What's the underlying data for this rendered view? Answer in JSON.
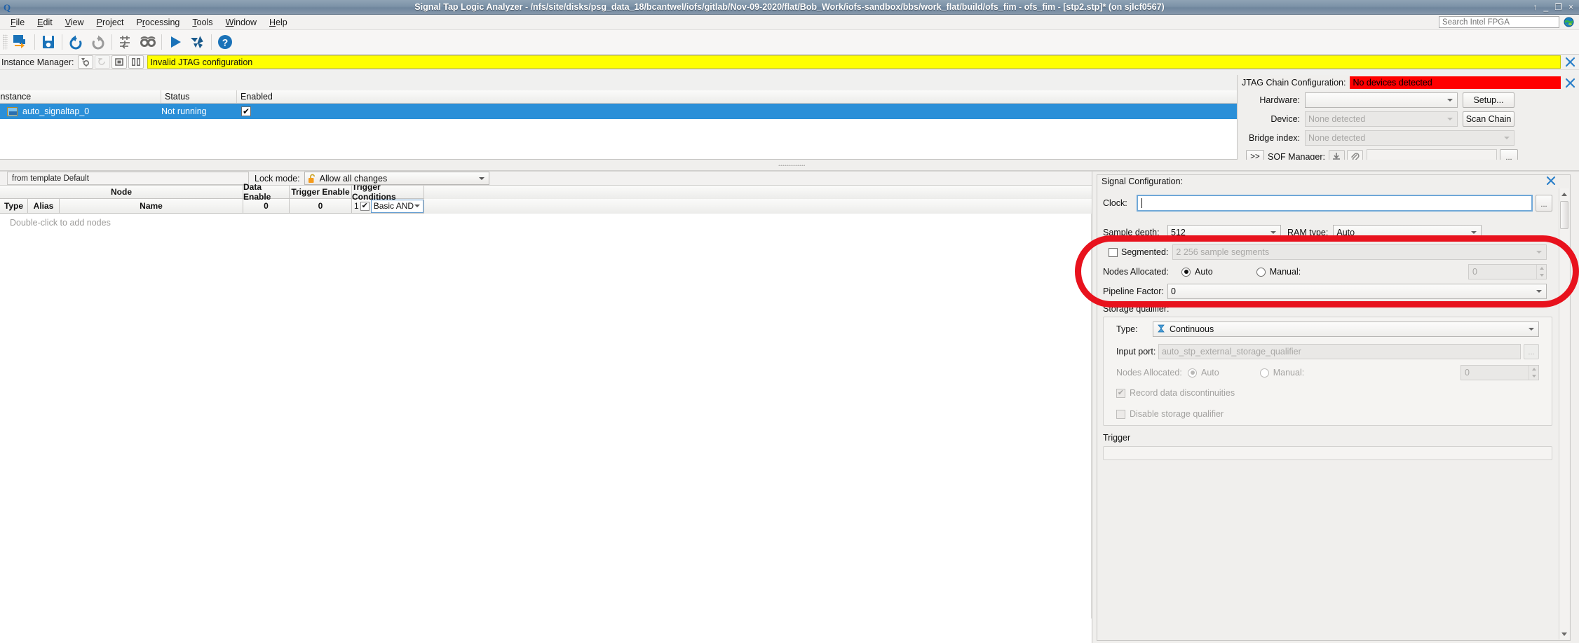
{
  "window": {
    "title": "Signal Tap Logic Analyzer - /nfs/site/disks/psg_data_18/bcantwel/iofs/gitlab/Nov-09-2020/flat/Bob_Work/iofs-sandbox/bbs/work_flat/build/ofs_fim - ofs_fim - [stp2.stp]* (on sjlcf0567)",
    "buttons": {
      "pin": "↑",
      "minimize": "_",
      "maximize": "❐",
      "close": "×"
    }
  },
  "menu": {
    "items": [
      {
        "label": "File",
        "mnemonic": "F"
      },
      {
        "label": "Edit",
        "mnemonic": "E"
      },
      {
        "label": "View",
        "mnemonic": "V"
      },
      {
        "label": "Project",
        "mnemonic": "P"
      },
      {
        "label": "Processing",
        "mnemonic": "r"
      },
      {
        "label": "Tools",
        "mnemonic": "T"
      },
      {
        "label": "Window",
        "mnemonic": "W"
      },
      {
        "label": "Help",
        "mnemonic": "H"
      }
    ],
    "search_placeholder": "Search Intel FPGA",
    "globe_icon": "globe-icon"
  },
  "toolbar": {
    "buttons": [
      {
        "name": "open-project-icon",
        "title": "Open Project"
      },
      {
        "name": "save-icon",
        "title": "Save"
      },
      {
        "name": "undo-icon",
        "title": "Undo"
      },
      {
        "name": "redo-icon",
        "title": "Redo"
      },
      {
        "name": "settings-icon",
        "title": "Settings"
      },
      {
        "name": "find-icon",
        "title": "Find"
      },
      {
        "name": "run-analysis-icon",
        "title": "Run Analysis"
      },
      {
        "name": "recompile-icon",
        "title": "Recompile"
      },
      {
        "name": "help-icon",
        "title": "Help"
      }
    ]
  },
  "instance_manager": {
    "label": "Instance Manager:",
    "buttons": [
      {
        "name": "run-analysis-icon",
        "enabled": true
      },
      {
        "name": "auto-run-icon",
        "enabled": false
      },
      {
        "name": "stop-analysis-icon",
        "enabled": true
      },
      {
        "name": "read-data-icon",
        "enabled": true
      }
    ],
    "status_warning": "Invalid JTAG configuration",
    "status_warning_bg": "#ffff00",
    "close_label": "×",
    "columns": [
      "Instance",
      "Status",
      "Enabled"
    ],
    "rows": [
      {
        "instance": "auto_signaltap_0",
        "status": "Not running",
        "enabled": true,
        "selected": true
      }
    ]
  },
  "jtag": {
    "title": "JTAG Chain Configuration:",
    "status": "No devices detected",
    "status_bg": "#ff0000",
    "close_label": "×",
    "fields": [
      {
        "label": "Hardware:",
        "value": "",
        "placeholder": "",
        "button": "Setup...",
        "disabled": false
      },
      {
        "label": "Device:",
        "value": "",
        "placeholder": "None detected",
        "button": "Scan Chain",
        "disabled": true
      },
      {
        "label": "Bridge index:",
        "value": "",
        "placeholder": "None detected",
        "button": "",
        "disabled": true
      }
    ],
    "sof": {
      "expand_label": ">>",
      "label": "SOF Manager:",
      "download_icon": "download-icon",
      "attach_icon": "paperclip-icon",
      "path_value": "",
      "browse_label": "..."
    }
  },
  "node_panel": {
    "template_label": "from template Default",
    "lock_mode_label": "Lock mode:",
    "lock_mode_value": "Allow all changes",
    "lock_icon": "open-padlock-icon",
    "header_group": "Node",
    "columns": {
      "type": "Type",
      "alias": "Alias",
      "name": "Name",
      "data_enable": "Data Enable",
      "trigger_enable": "Trigger Enable",
      "trigger_conditions": "Trigger Conditions"
    },
    "counts": {
      "data_enable": "0",
      "trigger_enable": "0",
      "trigger_conditions": "1"
    },
    "trigger_condition_checked": true,
    "trigger_condition_value": "Basic AND",
    "empty_hint": "Double-click to add nodes"
  },
  "signal_config": {
    "title": "Signal Configuration:",
    "close_label": "×",
    "clock": {
      "label": "Clock:",
      "value": "",
      "browse_label": "..."
    },
    "sample_depth": {
      "label": "Sample depth:",
      "value": "512"
    },
    "ram_type": {
      "label": "RAM type:",
      "value": "Auto"
    },
    "segmented": {
      "label": "Segmented:",
      "checked": false,
      "value": "2  256 sample segments",
      "disabled": true
    },
    "nodes_allocated": {
      "label": "Nodes Allocated:",
      "auto_label": "Auto",
      "manual_label": "Manual:",
      "selected": "Auto",
      "manual_value": "0"
    },
    "pipeline_factor": {
      "label": "Pipeline Factor:",
      "value": "0"
    },
    "storage_qualifier": {
      "label": "Storage qualifier:",
      "type_label": "Type:",
      "type_value": "Continuous",
      "type_icon": "hourglass-icon",
      "input_port_label": "Input port:",
      "input_port_value": "auto_stp_external_storage_qualifier",
      "input_port_browse": "...",
      "nodes_allocated_label": "Nodes Allocated:",
      "auto_label": "Auto",
      "manual_label": "Manual:",
      "selected": "Auto",
      "manual_value": "0",
      "record_discontinuities_label": "Record data discontinuities",
      "record_discontinuities_checked": true,
      "disable_qualifier_label": "Disable storage qualifier",
      "disable_qualifier_checked": false
    },
    "trigger_section_label": "Trigger"
  },
  "annotation": {
    "shape": "red-oval-highlight",
    "color": "#e8121d"
  }
}
